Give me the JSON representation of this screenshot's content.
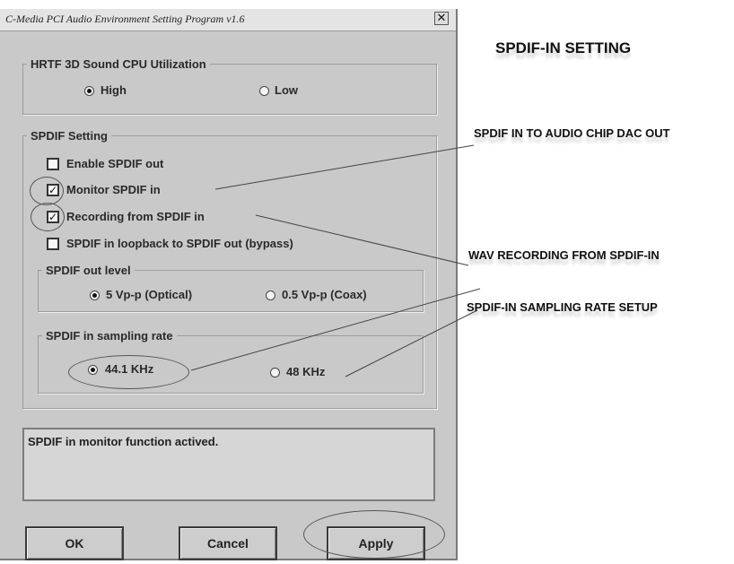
{
  "window": {
    "title": "C-Media PCI Audio Environment Setting Program v1.6",
    "close_glyph": "✕"
  },
  "hrtf": {
    "group_label": "HRTF 3D Sound CPU Utilization",
    "options": [
      {
        "label": "High",
        "selected": true
      },
      {
        "label": "Low",
        "selected": false
      }
    ]
  },
  "spdif": {
    "group_label": "SPDIF Setting",
    "checkboxes": [
      {
        "label": "Enable SPDIF out",
        "checked": false
      },
      {
        "label": "Monitor SPDIF in",
        "checked": true
      },
      {
        "label": "Recording from SPDIF in",
        "checked": true
      },
      {
        "label": "SPDIF in loopback to SPDIF out (bypass)",
        "checked": false
      }
    ],
    "out_level": {
      "group_label": "SPDIF out level",
      "options": [
        {
          "label": "5 Vp-p (Optical)",
          "selected": true
        },
        {
          "label": "0.5 Vp-p (Coax)",
          "selected": false
        }
      ]
    },
    "sampling_rate": {
      "group_label": "SPDIF in sampling rate",
      "options": [
        {
          "label": "44.1 KHz",
          "selected": true
        },
        {
          "label": "48 KHz",
          "selected": false
        }
      ]
    }
  },
  "status": {
    "message": "SPDIF in monitor function actived."
  },
  "buttons": {
    "ok": "OK",
    "cancel": "Cancel",
    "apply": "Apply"
  },
  "annotations": {
    "heading": "SPDIF-IN SETTING",
    "monitor": "SPDIF IN TO AUDIO CHIP DAC OUT",
    "recording": "WAV RECORDING FROM SPDIF-IN",
    "sampling": "SPDIF-IN SAMPLING RATE SETUP"
  }
}
